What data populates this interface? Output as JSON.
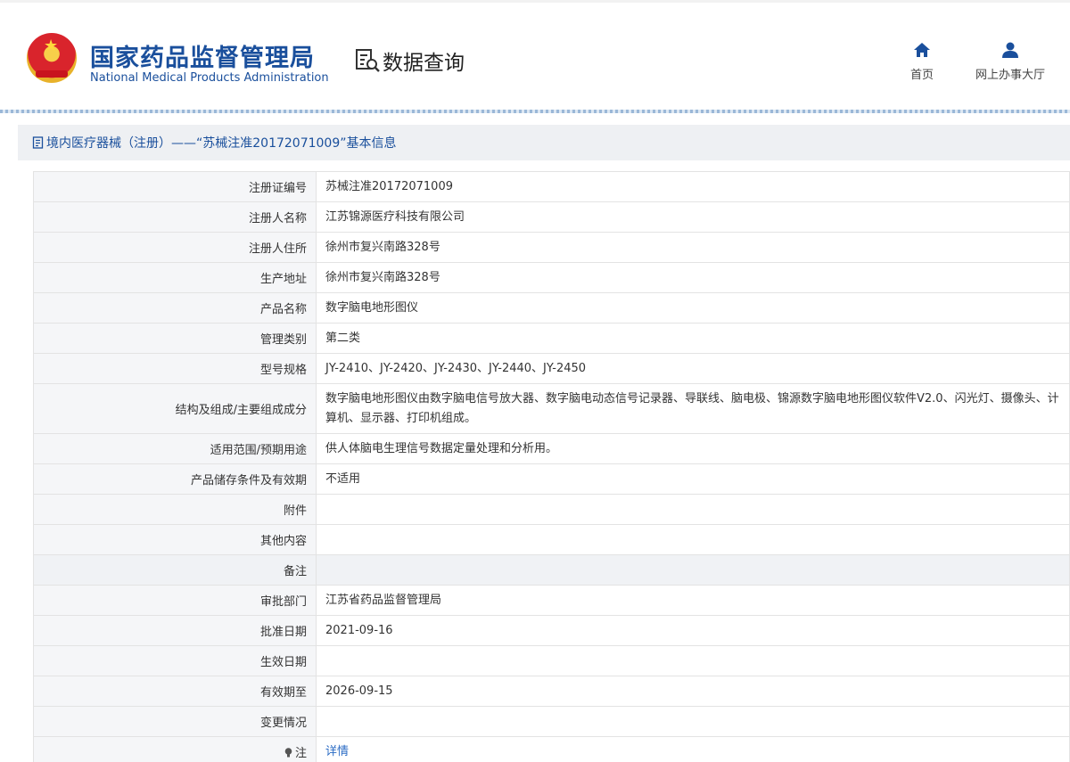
{
  "header": {
    "org_name_cn": "国家药品监督管理局",
    "org_name_en": "National Medical Products Administration",
    "section": "数据查询",
    "nav": [
      {
        "label": "首页",
        "icon": "home-icon"
      },
      {
        "label": "网上办事大厅",
        "icon": "user-icon"
      }
    ]
  },
  "title": "境内医疗器械（注册）——“苏械注准20172071009”基本信息",
  "rows": [
    {
      "label": "注册证编号",
      "value": "苏械注准20172071009"
    },
    {
      "label": "注册人名称",
      "value": "江苏锦源医疗科技有限公司"
    },
    {
      "label": "注册人住所",
      "value": "徐州市复兴南路328号"
    },
    {
      "label": "生产地址",
      "value": "徐州市复兴南路328号"
    },
    {
      "label": "产品名称",
      "value": "数字脑电地形图仪"
    },
    {
      "label": "管理类别",
      "value": "第二类"
    },
    {
      "label": "型号规格",
      "value": "JY-2410、JY-2420、JY-2430、JY-2440、JY-2450"
    },
    {
      "label": "结构及组成/主要组成成分",
      "value": "数字脑电地形图仪由数字脑电信号放大器、数字脑电动态信号记录器、导联线、脑电极、锦源数字脑电地形图仪软件V2.0、闪光灯、摄像头、计算机、显示器、打印机组成。"
    },
    {
      "label": "适用范围/预期用途",
      "value": "供人体脑电生理信号数据定量处理和分析用。"
    },
    {
      "label": "产品储存条件及有效期",
      "value": "不适用"
    },
    {
      "label": "附件",
      "value": ""
    },
    {
      "label": "其他内容",
      "value": ""
    },
    {
      "label": "备注",
      "value": ""
    },
    {
      "label": "审批部门",
      "value": "江苏省药品监督管理局"
    },
    {
      "label": "批准日期",
      "value": "2021-09-16"
    },
    {
      "label": "生效日期",
      "value": ""
    },
    {
      "label": "有效期至",
      "value": "2026-09-15"
    },
    {
      "label": "变更情况",
      "value": ""
    },
    {
      "label": "注",
      "value": "详情"
    }
  ],
  "colors": {
    "brand_blue": "#1a4f9c",
    "link_blue": "#2a6bc4"
  }
}
